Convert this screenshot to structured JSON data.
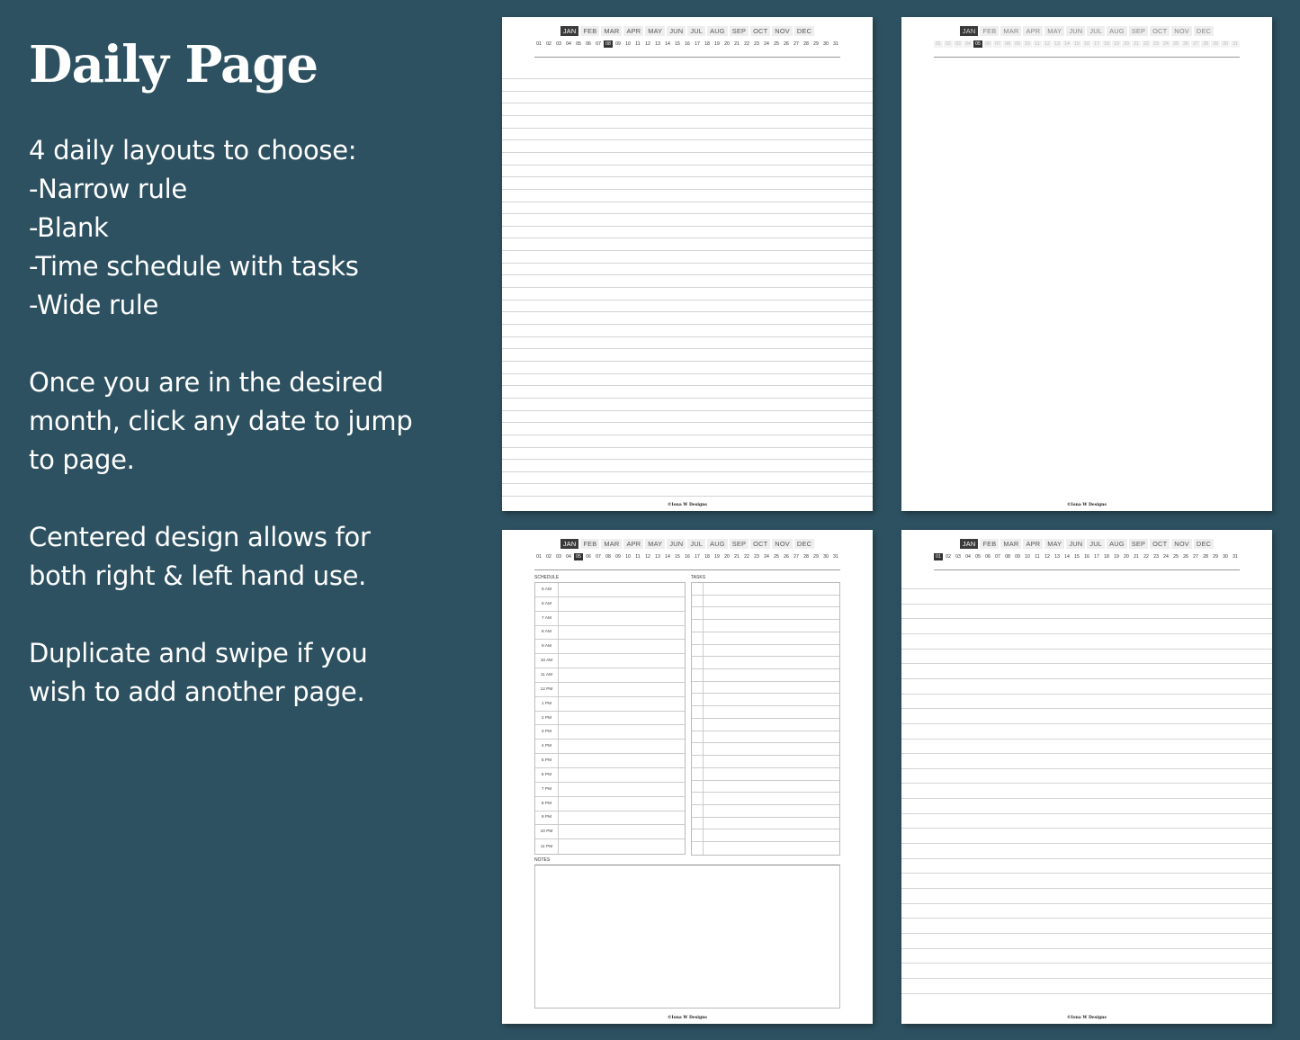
{
  "heading": "Daily Page",
  "intro": {
    "lines": [
      "4 daily layouts to choose:",
      "-Narrow rule",
      "-Blank",
      "-Time schedule with tasks",
      "-Wide rule"
    ]
  },
  "instructions": {
    "lines": [
      "Once you are in the desired",
      "month, click any date to jump",
      "to page."
    ]
  },
  "handedness": {
    "lines": [
      "Centered design allows for",
      "both right & left hand use."
    ]
  },
  "duplicate": {
    "lines": [
      "Duplicate and swipe if you",
      "wish to add another page."
    ]
  },
  "months": [
    "JAN",
    "FEB",
    "MAR",
    "APR",
    "MAY",
    "JUN",
    "JUL",
    "AUG",
    "SEP",
    "OCT",
    "NOV",
    "DEC"
  ],
  "days": [
    "01",
    "02",
    "03",
    "04",
    "05",
    "06",
    "07",
    "08",
    "09",
    "10",
    "11",
    "12",
    "13",
    "14",
    "15",
    "16",
    "17",
    "18",
    "19",
    "20",
    "21",
    "22",
    "23",
    "24",
    "25",
    "26",
    "27",
    "28",
    "29",
    "30",
    "31"
  ],
  "footer": "©Iona W Designs",
  "pages": [
    {
      "layout": "narrow-rule",
      "active_month": "JAN",
      "active_day": "08",
      "faded": false
    },
    {
      "layout": "blank",
      "active_month": "JAN",
      "active_day": "05",
      "faded": true
    },
    {
      "layout": "schedule-tasks",
      "active_month": "JAN",
      "active_day": "05",
      "faded": false
    },
    {
      "layout": "wide-rule",
      "active_month": "JAN",
      "active_day": "01",
      "faded": false
    }
  ],
  "schedule": {
    "label": "SCHEDULE",
    "times": [
      "5 AM",
      "6 AM",
      "7 AM",
      "8 AM",
      "9 AM",
      "10 AM",
      "11 AM",
      "12 PM",
      "1 PM",
      "2 PM",
      "3 PM",
      "4 PM",
      "5 PM",
      "6 PM",
      "7 PM",
      "8 PM",
      "9 PM",
      "10 PM",
      "11 PM"
    ]
  },
  "tasks": {
    "label": "TASKS",
    "row_count": 22
  },
  "notes": {
    "label": "NOTES"
  },
  "colors": {
    "background": "#2d5161",
    "active_tab": "#3a3a3a",
    "tab_bg": "#eeeeee"
  }
}
